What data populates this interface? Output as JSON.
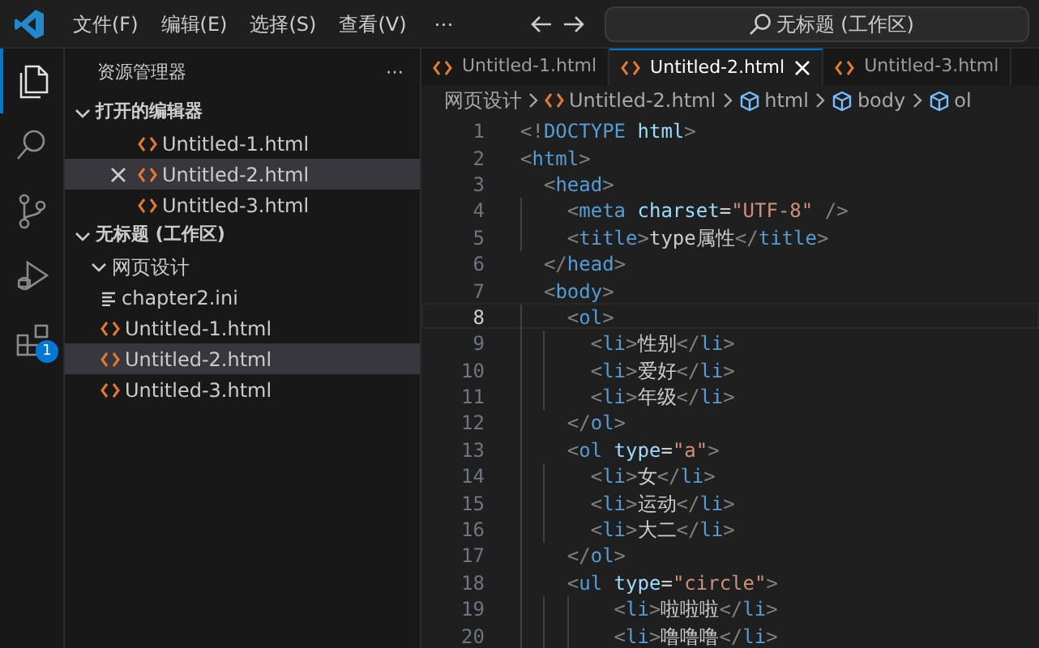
{
  "title_bar": {
    "menus": [
      "文件(F)",
      "编辑(E)",
      "选择(S)",
      "查看(V)"
    ],
    "more": "⋯",
    "command_center": "无标题 (工作区)"
  },
  "activity_bar": [
    {
      "kind": "explorer",
      "selected": true
    },
    {
      "kind": "search",
      "selected": false
    },
    {
      "kind": "source-control",
      "selected": false
    },
    {
      "kind": "run-debug",
      "selected": false
    },
    {
      "kind": "extensions",
      "selected": false,
      "badge": "1"
    }
  ],
  "sidebar": {
    "title": "资源管理器",
    "more": "⋯",
    "sections": [
      {
        "title": "打开的编辑器",
        "expanded": true,
        "items": [
          {
            "label": "Untitled-1.html",
            "kind": "html",
            "selected": false
          },
          {
            "label": "Untitled-2.html",
            "kind": "html",
            "selected": true
          },
          {
            "label": "Untitled-3.html",
            "kind": "html",
            "selected": false
          }
        ]
      },
      {
        "title": "无标题 (工作区)",
        "expanded": true,
        "items": [
          {
            "label": "网页设计",
            "kind": "folder",
            "expanded": true,
            "selected": false,
            "children": [
              {
                "label": "chapter2.ini",
                "kind": "ini",
                "selected": false
              },
              {
                "label": "Untitled-1.html",
                "kind": "html",
                "selected": false
              },
              {
                "label": "Untitled-2.html",
                "kind": "html",
                "selected": true
              },
              {
                "label": "Untitled-3.html",
                "kind": "html",
                "selected": false
              }
            ]
          }
        ]
      }
    ]
  },
  "tabs": [
    {
      "label": "Untitled-1.html",
      "selected": false
    },
    {
      "label": "Untitled-2.html",
      "selected": true
    },
    {
      "label": "Untitled-3.html",
      "selected": false
    }
  ],
  "breadcrumb": [
    {
      "label": "网页设计",
      "kind": "folder"
    },
    {
      "label": "Untitled-2.html",
      "kind": "html"
    },
    {
      "label": "html",
      "kind": "element"
    },
    {
      "label": "body",
      "kind": "element"
    },
    {
      "label": "ol",
      "kind": "element"
    }
  ],
  "code": [
    {
      "number": "1",
      "current": false,
      "tokens": [
        {
          "kind": "p",
          "text": "<!"
        },
        {
          "kind": "k",
          "text": "DOCTYPE"
        },
        {
          "kind": "a",
          "text": " html"
        },
        {
          "kind": "p",
          "text": ">"
        }
      ]
    },
    {
      "number": "2",
      "current": false,
      "tokens": [
        {
          "kind": "p",
          "text": "<"
        },
        {
          "kind": "k",
          "text": "html"
        },
        {
          "kind": "p",
          "text": ">"
        }
      ]
    },
    {
      "number": "3",
      "current": false,
      "tokens": [
        {
          "kind": "p",
          "text": "  <"
        },
        {
          "kind": "k",
          "text": "head"
        },
        {
          "kind": "p",
          "text": ">"
        }
      ]
    },
    {
      "number": "4",
      "current": false,
      "tokens": [
        {
          "kind": "p",
          "text": "    <"
        },
        {
          "kind": "k",
          "text": "meta"
        },
        {
          "kind": "a",
          "text": " charset"
        },
        {
          "kind": "x",
          "text": "="
        },
        {
          "kind": "s",
          "text": "\"UTF-8\""
        },
        {
          "kind": "p",
          "text": " />"
        }
      ]
    },
    {
      "number": "5",
      "current": false,
      "tokens": [
        {
          "kind": "p",
          "text": "    <"
        },
        {
          "kind": "k",
          "text": "title"
        },
        {
          "kind": "p",
          "text": ">"
        },
        {
          "kind": "x",
          "text": "type属性"
        },
        {
          "kind": "p",
          "text": "</"
        },
        {
          "kind": "k",
          "text": "title"
        },
        {
          "kind": "p",
          "text": ">"
        }
      ]
    },
    {
      "number": "6",
      "current": false,
      "tokens": [
        {
          "kind": "p",
          "text": "  </"
        },
        {
          "kind": "k",
          "text": "head"
        },
        {
          "kind": "p",
          "text": ">"
        }
      ]
    },
    {
      "number": "7",
      "current": false,
      "tokens": [
        {
          "kind": "p",
          "text": "  <"
        },
        {
          "kind": "k",
          "text": "body"
        },
        {
          "kind": "p",
          "text": ">"
        }
      ]
    },
    {
      "number": "8",
      "current": true,
      "tokens": [
        {
          "kind": "p",
          "text": "    <"
        },
        {
          "kind": "k",
          "text": "ol"
        },
        {
          "kind": "p",
          "text": ">"
        }
      ]
    },
    {
      "number": "9",
      "current": false,
      "tokens": [
        {
          "kind": "p",
          "text": "      <"
        },
        {
          "kind": "k",
          "text": "li"
        },
        {
          "kind": "p",
          "text": ">"
        },
        {
          "kind": "x",
          "text": "性别"
        },
        {
          "kind": "p",
          "text": "</"
        },
        {
          "kind": "k",
          "text": "li"
        },
        {
          "kind": "p",
          "text": ">"
        }
      ]
    },
    {
      "number": "10",
      "current": false,
      "tokens": [
        {
          "kind": "p",
          "text": "      <"
        },
        {
          "kind": "k",
          "text": "li"
        },
        {
          "kind": "p",
          "text": ">"
        },
        {
          "kind": "x",
          "text": "爱好"
        },
        {
          "kind": "p",
          "text": "</"
        },
        {
          "kind": "k",
          "text": "li"
        },
        {
          "kind": "p",
          "text": ">"
        }
      ]
    },
    {
      "number": "11",
      "current": false,
      "tokens": [
        {
          "kind": "p",
          "text": "      <"
        },
        {
          "kind": "k",
          "text": "li"
        },
        {
          "kind": "p",
          "text": ">"
        },
        {
          "kind": "x",
          "text": "年级"
        },
        {
          "kind": "p",
          "text": "</"
        },
        {
          "kind": "k",
          "text": "li"
        },
        {
          "kind": "p",
          "text": ">"
        }
      ]
    },
    {
      "number": "12",
      "current": false,
      "tokens": [
        {
          "kind": "p",
          "text": "    </"
        },
        {
          "kind": "k",
          "text": "ol"
        },
        {
          "kind": "p",
          "text": ">"
        }
      ]
    },
    {
      "number": "13",
      "current": false,
      "tokens": [
        {
          "kind": "p",
          "text": "    <"
        },
        {
          "kind": "k",
          "text": "ol"
        },
        {
          "kind": "a",
          "text": " type"
        },
        {
          "kind": "x",
          "text": "="
        },
        {
          "kind": "s",
          "text": "\"a\""
        },
        {
          "kind": "p",
          "text": ">"
        }
      ]
    },
    {
      "number": "14",
      "current": false,
      "tokens": [
        {
          "kind": "p",
          "text": "      <"
        },
        {
          "kind": "k",
          "text": "li"
        },
        {
          "kind": "p",
          "text": ">"
        },
        {
          "kind": "x",
          "text": "女"
        },
        {
          "kind": "p",
          "text": "</"
        },
        {
          "kind": "k",
          "text": "li"
        },
        {
          "kind": "p",
          "text": ">"
        }
      ]
    },
    {
      "number": "15",
      "current": false,
      "tokens": [
        {
          "kind": "p",
          "text": "      <"
        },
        {
          "kind": "k",
          "text": "li"
        },
        {
          "kind": "p",
          "text": ">"
        },
        {
          "kind": "x",
          "text": "运动"
        },
        {
          "kind": "p",
          "text": "</"
        },
        {
          "kind": "k",
          "text": "li"
        },
        {
          "kind": "p",
          "text": ">"
        }
      ]
    },
    {
      "number": "16",
      "current": false,
      "tokens": [
        {
          "kind": "p",
          "text": "      <"
        },
        {
          "kind": "k",
          "text": "li"
        },
        {
          "kind": "p",
          "text": ">"
        },
        {
          "kind": "x",
          "text": "大二"
        },
        {
          "kind": "p",
          "text": "</"
        },
        {
          "kind": "k",
          "text": "li"
        },
        {
          "kind": "p",
          "text": ">"
        }
      ]
    },
    {
      "number": "17",
      "current": false,
      "tokens": [
        {
          "kind": "p",
          "text": "    </"
        },
        {
          "kind": "k",
          "text": "ol"
        },
        {
          "kind": "p",
          "text": ">"
        }
      ]
    },
    {
      "number": "18",
      "current": false,
      "tokens": [
        {
          "kind": "p",
          "text": "    <"
        },
        {
          "kind": "k",
          "text": "ul"
        },
        {
          "kind": "a",
          "text": " type"
        },
        {
          "kind": "x",
          "text": "="
        },
        {
          "kind": "s",
          "text": "\"circle\""
        },
        {
          "kind": "p",
          "text": ">"
        }
      ]
    },
    {
      "number": "19",
      "current": false,
      "tokens": [
        {
          "kind": "p",
          "text": "        <"
        },
        {
          "kind": "k",
          "text": "li"
        },
        {
          "kind": "p",
          "text": ">"
        },
        {
          "kind": "x",
          "text": "啦啦啦"
        },
        {
          "kind": "p",
          "text": "</"
        },
        {
          "kind": "k",
          "text": "li"
        },
        {
          "kind": "p",
          "text": ">"
        }
      ]
    },
    {
      "number": "20",
      "current": false,
      "tokens": [
        {
          "kind": "p",
          "text": "        <"
        },
        {
          "kind": "k",
          "text": "li"
        },
        {
          "kind": "p",
          "text": ">"
        },
        {
          "kind": "x",
          "text": "噜噜噜"
        },
        {
          "kind": "p",
          "text": "</"
        },
        {
          "kind": "k",
          "text": "li"
        },
        {
          "kind": "p",
          "text": ">"
        }
      ]
    }
  ]
}
